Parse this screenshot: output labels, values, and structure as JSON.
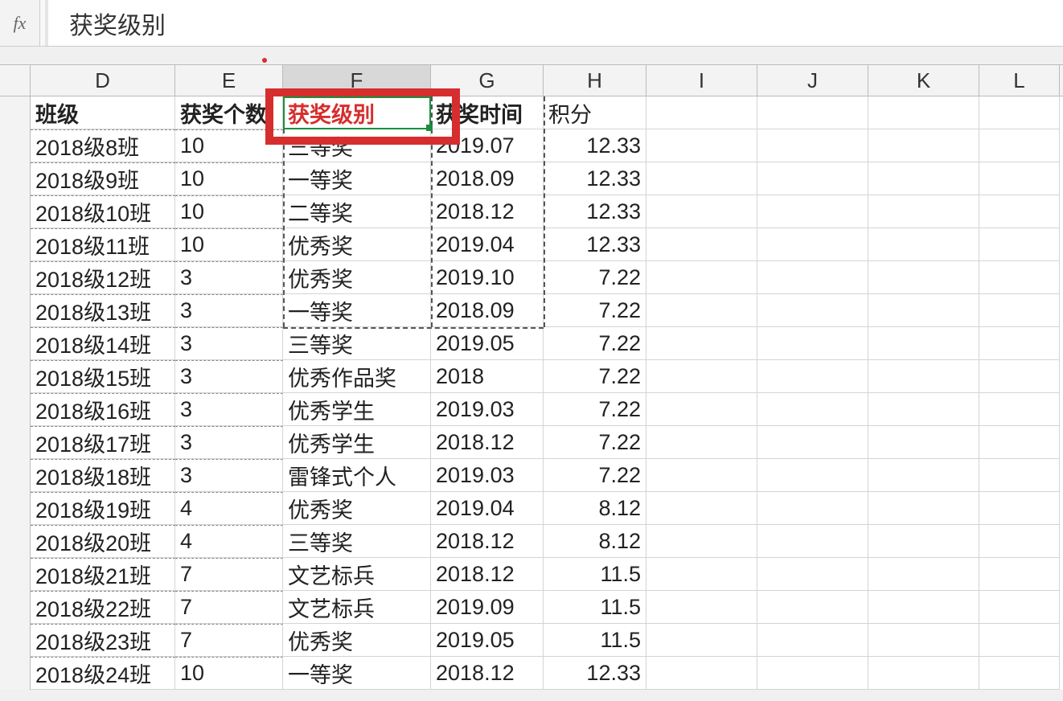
{
  "formula_bar": {
    "fx_label": "fx",
    "value": "获奖级别"
  },
  "columns": [
    "D",
    "E",
    "F",
    "G",
    "H",
    "I",
    "J",
    "K",
    "L"
  ],
  "selected_column": "F",
  "headers": {
    "D": "班级",
    "E": "获奖个数",
    "F": "获奖级别",
    "G": "获奖时间",
    "H": "积分"
  },
  "rows": [
    {
      "D": "2018级8班",
      "E": "10",
      "F": "三等奖",
      "G": "2019.07",
      "H": "12.33"
    },
    {
      "D": "2018级9班",
      "E": "10",
      "F": "一等奖",
      "G": "2018.09",
      "H": "12.33"
    },
    {
      "D": "2018级10班",
      "E": "10",
      "F": "二等奖",
      "G": "2018.12",
      "H": "12.33"
    },
    {
      "D": "2018级11班",
      "E": "10",
      "F": "优秀奖",
      "G": "2019.04",
      "H": "12.33"
    },
    {
      "D": "2018级12班",
      "E": "3",
      "F": "优秀奖",
      "G": "2019.10",
      "H": "7.22"
    },
    {
      "D": "2018级13班",
      "E": "3",
      "F": "一等奖",
      "G": "2018.09",
      "H": "7.22"
    },
    {
      "D": "2018级14班",
      "E": "3",
      "F": "三等奖",
      "G": "2019.05",
      "H": "7.22"
    },
    {
      "D": "2018级15班",
      "E": "3",
      "F": "优秀作品奖",
      "G": "2018",
      "H": "7.22"
    },
    {
      "D": "2018级16班",
      "E": "3",
      "F": "优秀学生",
      "G": "2019.03",
      "H": "7.22"
    },
    {
      "D": "2018级17班",
      "E": "3",
      "F": "优秀学生",
      "G": "2018.12",
      "H": "7.22"
    },
    {
      "D": "2018级18班",
      "E": "3",
      "F": "雷锋式个人",
      "G": "2019.03",
      "H": "7.22"
    },
    {
      "D": "2018级19班",
      "E": "4",
      "F": "优秀奖",
      "G": "2019.04",
      "H": "8.12"
    },
    {
      "D": "2018级20班",
      "E": "4",
      "F": "三等奖",
      "G": "2018.12",
      "H": "8.12"
    },
    {
      "D": "2018级21班",
      "E": "7",
      "F": "文艺标兵",
      "G": "2018.12",
      "H": "11.5"
    },
    {
      "D": "2018级22班",
      "E": "7",
      "F": "文艺标兵",
      "G": "2019.09",
      "H": "11.5"
    },
    {
      "D": "2018级23班",
      "E": "7",
      "F": "优秀奖",
      "G": "2019.05",
      "H": "11.5"
    },
    {
      "D": "2018级24班",
      "E": "10",
      "F": "一等奖",
      "G": "2018.12",
      "H": "12.33"
    }
  ]
}
